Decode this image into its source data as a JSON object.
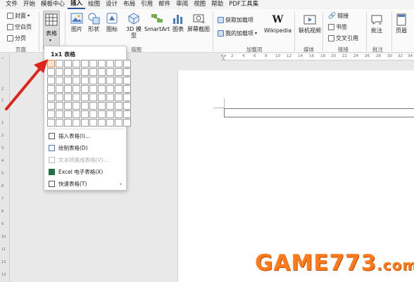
{
  "menubar": {
    "items": [
      "文件",
      "开始",
      "模板中心",
      "插入",
      "绘图",
      "设计",
      "布局",
      "引用",
      "邮件",
      "审阅",
      "视图",
      "帮助",
      "PDF工具集"
    ],
    "active": "插入"
  },
  "ribbon": {
    "pages_group": {
      "label": "页面",
      "cover": "封面",
      "blank_page": "空白页",
      "page_break": "分页"
    },
    "table_button": {
      "label": "表格"
    },
    "illustrations_group": {
      "label": "插图",
      "picture": "图片",
      "shapes": "形状",
      "icons": "图标",
      "3d_model": "3D 模型",
      "smartart": "SmartArt",
      "chart": "图表",
      "screenshot": "屏幕截图"
    },
    "addins_group": {
      "label": "加载项",
      "get_addins": "获取加载项",
      "my_addins": "我的加载项",
      "wikipedia": "Wikipedia"
    },
    "media_group": {
      "label": "媒体",
      "online_video": "联机视频"
    },
    "links_group": {
      "label": "链接",
      "link": "链接",
      "bookmark": "书签",
      "cross_reference": "交叉引用"
    },
    "comments_group": {
      "label": "批注",
      "comment": "批注"
    },
    "header_footer_group": {
      "label": "页眉"
    }
  },
  "ruler": {
    "horizontal": [
      "2",
      "4",
      "6",
      "8",
      "10",
      "12",
      "14",
      "16",
      "18",
      "20",
      "22",
      "24",
      "26",
      "28",
      "30",
      "32",
      "34"
    ],
    "vertical": [
      "2",
      "1",
      "1",
      "2",
      "3",
      "4",
      "5",
      "6",
      "7",
      "8",
      "9",
      "10",
      "11",
      "12",
      "13",
      "14",
      "15"
    ]
  },
  "table_dropdown": {
    "grid_label": "1x1 表格",
    "grid_columns": 10,
    "grid_rows": 8,
    "selected_cols": 1,
    "selected_rows": 1,
    "items": [
      {
        "label": "插入表格(I)...",
        "icon": "insert-table-icon",
        "disabled": false
      },
      {
        "label": "绘制表格(D)",
        "icon": "draw-table-icon",
        "disabled": false
      },
      {
        "label": "文本转换成表格(V)...",
        "icon": "text-to-table-icon",
        "disabled": true
      },
      {
        "label": "Excel 电子表格(X)",
        "icon": "excel-icon",
        "disabled": false
      },
      {
        "label": "快速表格(T)",
        "icon": "quick-tables-icon",
        "disabled": false,
        "submenu": true
      }
    ]
  },
  "watermark": {
    "text": "GAME773",
    "suffix": ".com"
  },
  "colors": {
    "accent": "#2b579a",
    "annotation_arrow": "#e0231c",
    "grid_selected": "#fde3cf",
    "watermark": "#ff7a1a"
  }
}
